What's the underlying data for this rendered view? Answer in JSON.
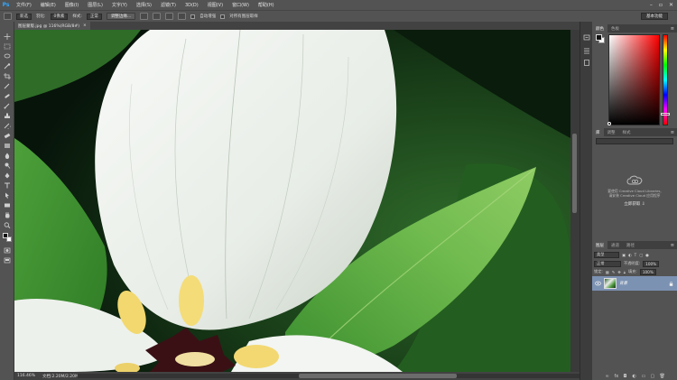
{
  "app": {
    "logo": "Ps"
  },
  "menu": [
    "文件(F)",
    "编辑(E)",
    "图像(I)",
    "图层(L)",
    "文字(Y)",
    "选择(S)",
    "滤镜(T)",
    "3D(D)",
    "视图(V)",
    "窗口(W)",
    "帮助(H)"
  ],
  "window_controls": [
    "–",
    "▫",
    "✕"
  ],
  "options_bar": {
    "mode": "新选",
    "feather_label": "羽化:",
    "feather_value": "0像素",
    "style_label": "样式:",
    "style_value": "正常",
    "refine_edge": "调整边缘...",
    "auto_enhance": "自动增强",
    "sample_all": "对所有图层取样",
    "workspace": "基本功能"
  },
  "document": {
    "tab_title": "图层蒙版.jpg @ 116%(RGB/8#)",
    "tab_close": "×",
    "zoom": "116.46%",
    "doc_info": "文档:2.20M/2.20M"
  },
  "color_panel": {
    "tabs": [
      "颜色",
      "色板"
    ]
  },
  "libraries_panel": {
    "tabs": [
      "库",
      "调整",
      "样式"
    ],
    "message_line1": "要使用 Creative Cloud Libraries,",
    "message_line2": "请安装 Creative Cloud 应用程序",
    "link": "立即获取 ⇩"
  },
  "layers_panel": {
    "tabs": [
      "图层",
      "通道",
      "路径"
    ],
    "kind_filter": "类型",
    "blend_mode": "正常",
    "opacity_label": "不透明度:",
    "opacity_value": "100%",
    "lock_label": "锁定:",
    "fill_label": "填充:",
    "fill_value": "100%",
    "layers": [
      {
        "name": "背景"
      }
    ]
  },
  "colors": {
    "menubar": "#535353",
    "canvas_bg": "#0c1a0d",
    "selected_layer": "#7c92b3",
    "ps_blue": "#31a8ff"
  }
}
